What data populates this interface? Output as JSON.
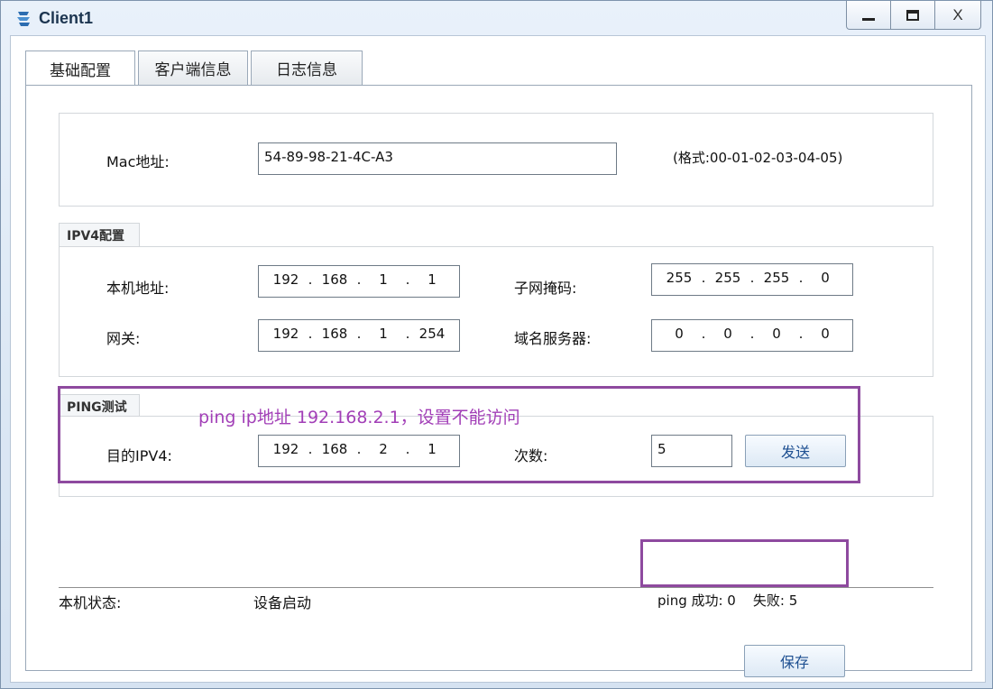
{
  "window": {
    "title": "Client1",
    "minimize_icon": "minimize-icon",
    "maximize_icon": "maximize-icon",
    "close_label": "X"
  },
  "tabs": [
    {
      "label": "基础配置",
      "active": true
    },
    {
      "label": "客户端信息",
      "active": false
    },
    {
      "label": "日志信息",
      "active": false
    }
  ],
  "mac": {
    "label": "Mac地址:",
    "value": "54-89-98-21-4C-A3",
    "format_hint": "(格式:00-01-02-03-04-05)"
  },
  "ipv4": {
    "group_label": "IPV4配置",
    "local_ip": {
      "label": "本机地址:",
      "octets": [
        "192",
        "168",
        "1",
        "1"
      ]
    },
    "subnet_mask": {
      "label": "子网掩码:",
      "octets": [
        "255",
        "255",
        "255",
        "0"
      ]
    },
    "gateway": {
      "label": "网关:",
      "octets": [
        "192",
        "168",
        "1",
        "254"
      ]
    },
    "dns": {
      "label": "域名服务器:",
      "octets": [
        "0",
        "0",
        "0",
        "0"
      ]
    }
  },
  "ping": {
    "group_label": "PING测试",
    "dest_label": "目的IPV4:",
    "dest_octets": [
      "192",
      "168",
      "2",
      "1"
    ],
    "count_label": "次数:",
    "count_value": "5",
    "send_label": "发送"
  },
  "status": {
    "label": "本机状态:",
    "value": "设备启动",
    "ping_result": "ping 成功: 0    失败: 5"
  },
  "save_label": "保存",
  "annotation": {
    "text": "ping  ip地址 192.168.2.1，设置不能访问",
    "color": "#a23fb7",
    "box_color": "#8e4a9f"
  }
}
